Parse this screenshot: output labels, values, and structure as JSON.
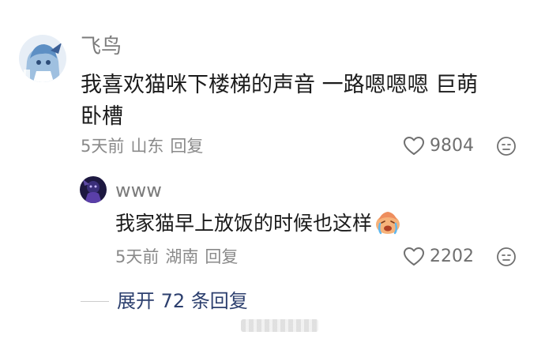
{
  "comment": {
    "username": "飞鸟",
    "text_line1": "我喜欢猫咪下楼梯的声音 一路嗯嗯嗯 巨萌",
    "text_line2": "卧槽",
    "time": "5天前",
    "location": "山东",
    "reply_label": "回复",
    "likes": "9804"
  },
  "reply": {
    "username": "www",
    "text": "我家猫早上放饭的时候也这样",
    "emoji_icon": "crying-face-emoji",
    "time": "5天前",
    "location": "湖南",
    "reply_label": "回复",
    "likes": "2202"
  },
  "expand_label": "展开 72 条回复",
  "colors": {
    "meta": "#8a8a8a",
    "expand": "#2c3f6e",
    "username": "#7b7b7b"
  }
}
